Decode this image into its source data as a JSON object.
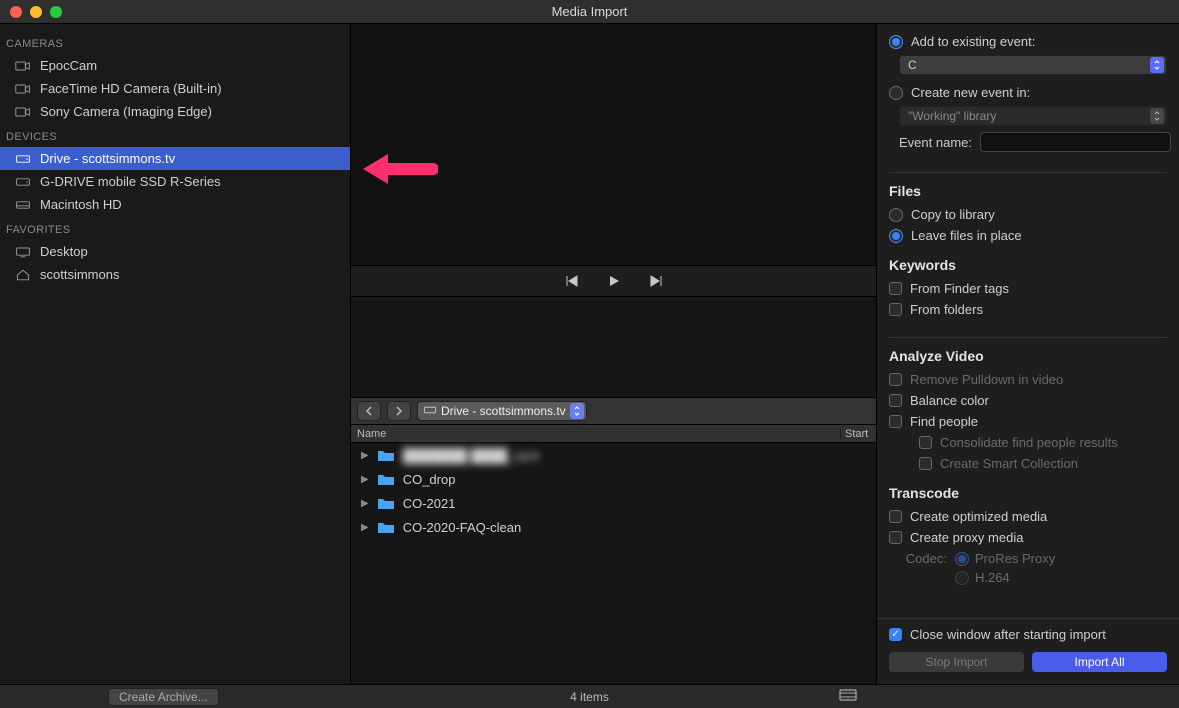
{
  "window_title": "Media Import",
  "sidebar": {
    "cameras_label": "CAMERAS",
    "cameras": [
      {
        "name": "EpocCam"
      },
      {
        "name": "FaceTime HD Camera (Built-in)"
      },
      {
        "name": "Sony Camera (Imaging Edge)"
      }
    ],
    "devices_label": "DEVICES",
    "devices": [
      {
        "name": "Drive - scottsimmons.tv",
        "selected": true
      },
      {
        "name": "G-DRIVE mobile SSD R-Series"
      },
      {
        "name": "Macintosh HD"
      }
    ],
    "favorites_label": "FAVORITES",
    "favorites": [
      {
        "name": "Desktop"
      },
      {
        "name": "scottsimmons"
      }
    ]
  },
  "path_dropdown": "Drive - scottsimmons.tv",
  "table": {
    "name_col": "Name",
    "start_col": "Start",
    "rows": [
      {
        "name": "███████ ████_spot",
        "blurred": true
      },
      {
        "name": "CO_drop"
      },
      {
        "name": "CO-2021"
      },
      {
        "name": "CO-2020-FAQ-clean"
      }
    ]
  },
  "right": {
    "add_existing": "Add to existing event:",
    "add_existing_value": "C",
    "create_new": "Create new event in:",
    "create_new_value": "\"Working\" library",
    "event_name_label": "Event name:",
    "files_heading": "Files",
    "copy_library": "Copy to library",
    "leave_in_place": "Leave files in place",
    "keywords_heading": "Keywords",
    "from_finder": "From Finder tags",
    "from_folders": "From folders",
    "analyze_heading": "Analyze Video",
    "remove_pulldown": "Remove Pulldown in video",
    "balance_color": "Balance color",
    "find_people": "Find people",
    "consolidate": "Consolidate find people results",
    "smart_collection": "Create Smart Collection",
    "transcode_heading": "Transcode",
    "optimized": "Create optimized media",
    "proxy": "Create proxy media",
    "codec_label": "Codec:",
    "codec_prores": "ProRes Proxy",
    "codec_h264": "H.264",
    "close_after": "Close window after starting import",
    "stop_import": "Stop Import",
    "import_all": "Import All"
  },
  "bottom": {
    "create_archive": "Create Archive...",
    "item_count": "4 items"
  }
}
